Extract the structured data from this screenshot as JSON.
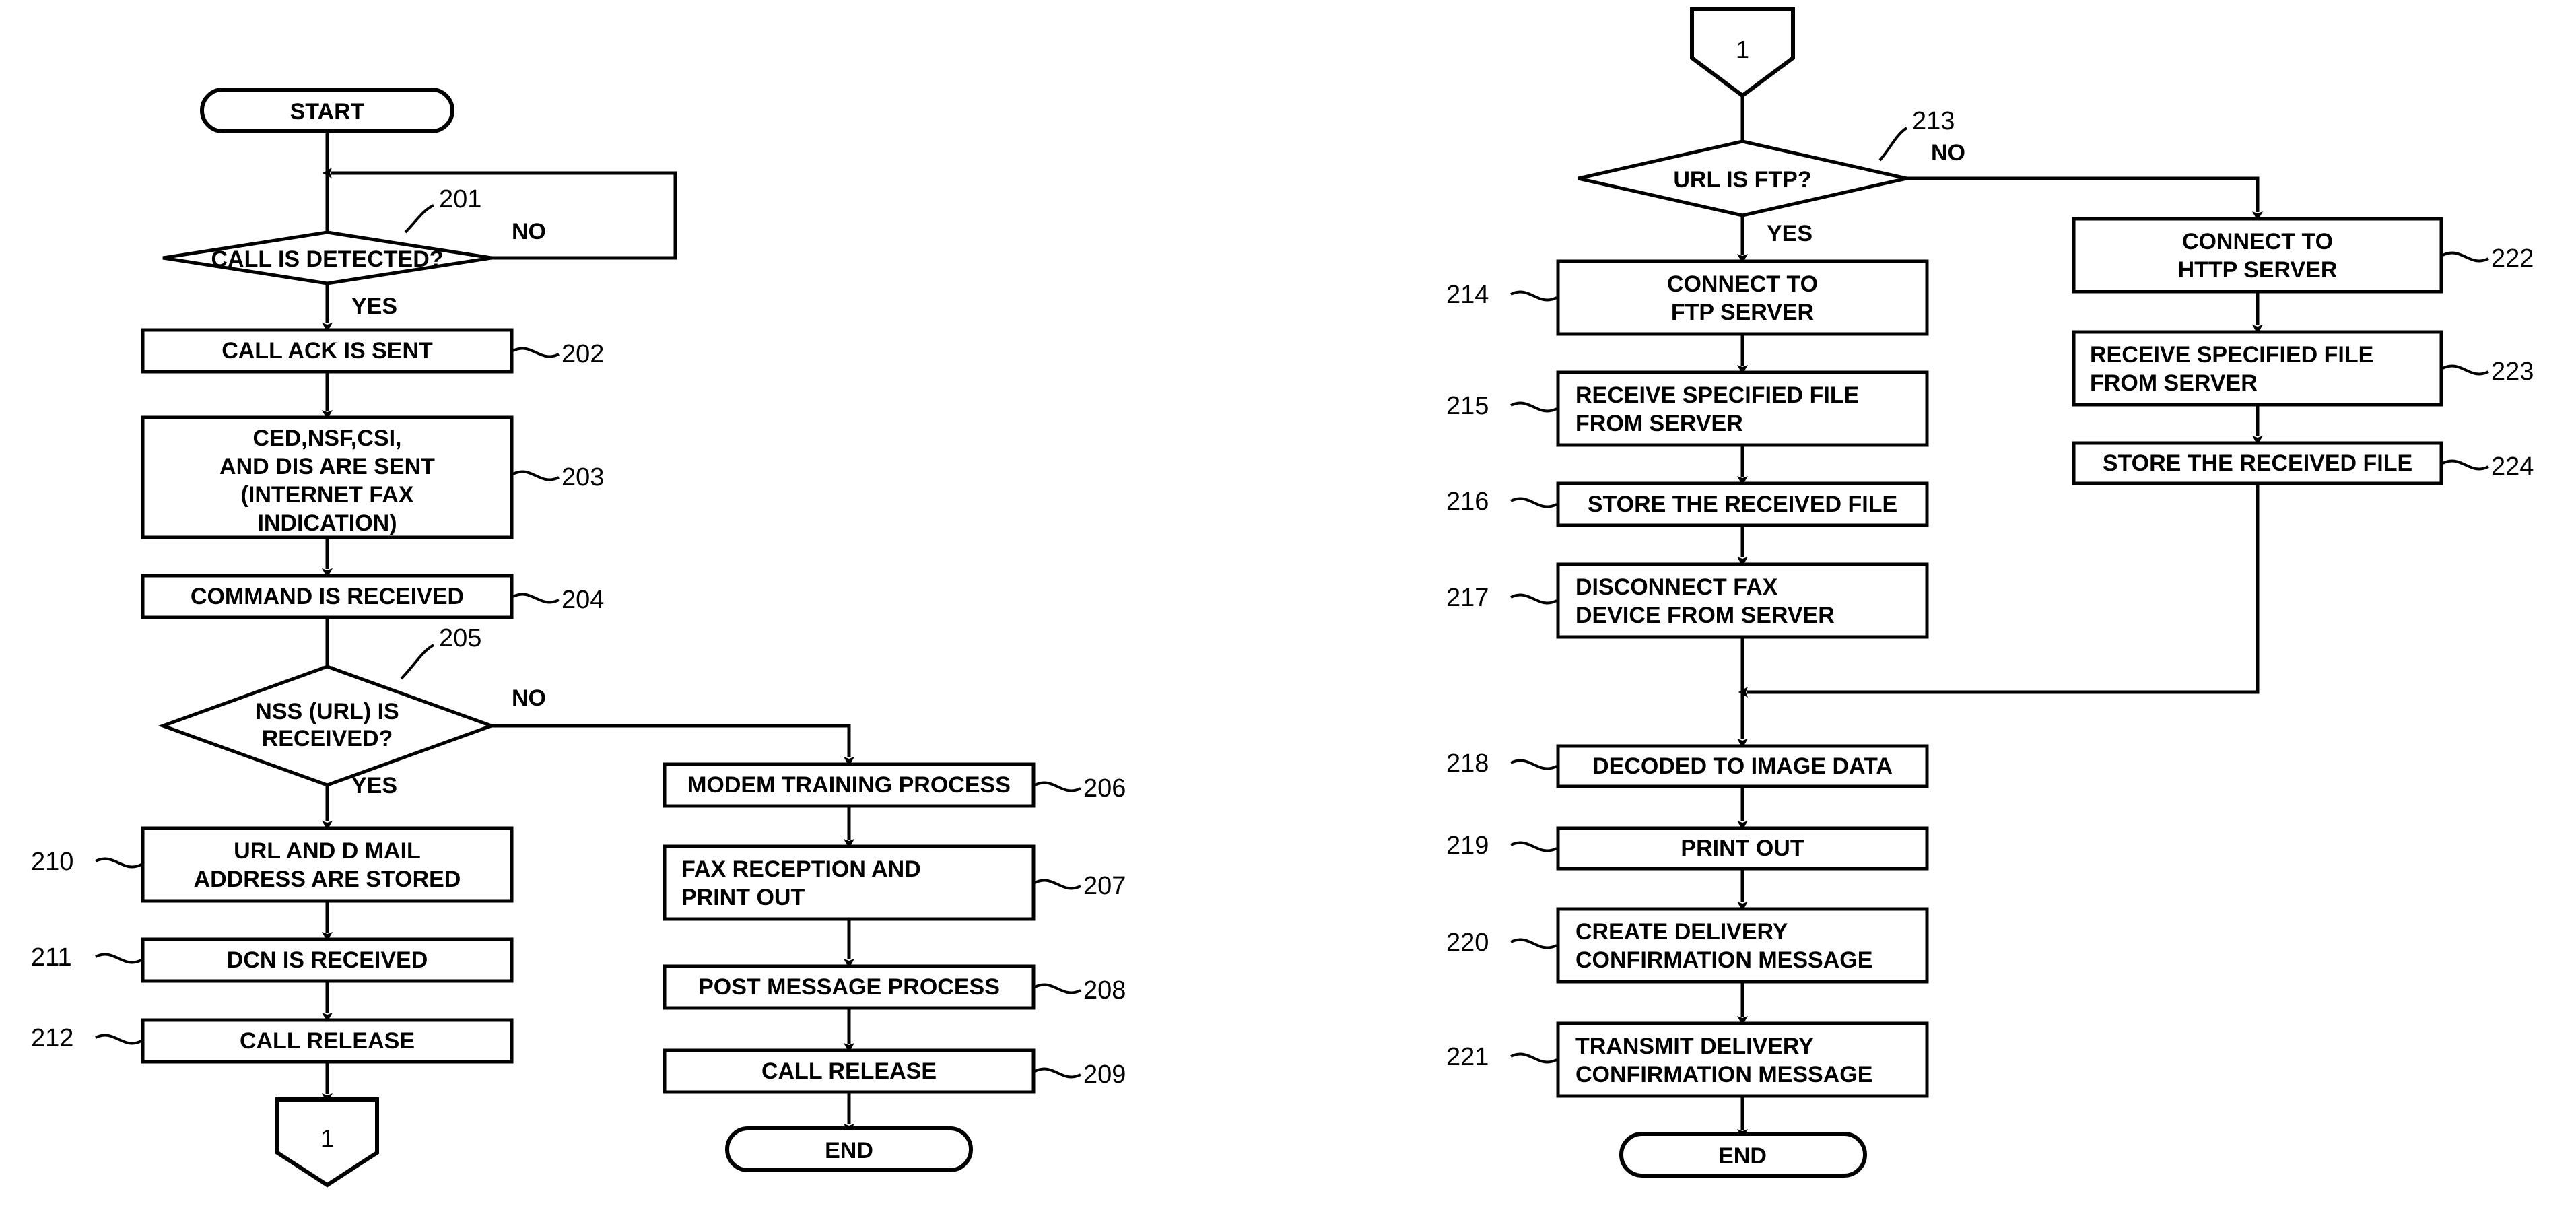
{
  "figure": {
    "kind": "patent-flowchart",
    "background_color": "#ffffff",
    "line_color": "#000000"
  },
  "left_flow": {
    "terminal_start": "START",
    "decision_201": {
      "ref": "201",
      "text": "CALL IS DETECTED?",
      "yes": "YES",
      "no": "NO"
    },
    "box_202": {
      "ref": "202",
      "text": "CALL ACK IS SENT"
    },
    "box_203": {
      "ref": "203",
      "line1": "CED,NSF,CSI,",
      "line2": "AND DIS ARE SENT",
      "line3": "(INTERNET FAX",
      "line4": "INDICATION)"
    },
    "box_204": {
      "ref": "204",
      "text": "COMMAND IS RECEIVED"
    },
    "decision_205": {
      "ref": "205",
      "line1": "NSS (URL) IS",
      "line2": "RECEIVED?",
      "yes": "YES",
      "no": "NO"
    },
    "box_210": {
      "ref": "210",
      "line1": "URL AND D MAIL",
      "line2": "ADDRESS ARE STORED"
    },
    "box_211": {
      "ref": "211",
      "text": "DCN IS RECEIVED"
    },
    "box_212": {
      "ref": "212",
      "text": "CALL RELEASE"
    },
    "connector_out": "1"
  },
  "middle_flow": {
    "box_206": {
      "ref": "206",
      "text": "MODEM TRAINING PROCESS"
    },
    "box_207": {
      "ref": "207",
      "line1": "FAX RECEPTION AND",
      "line2": "PRINT OUT"
    },
    "box_208": {
      "ref": "208",
      "text": "POST MESSAGE PROCESS"
    },
    "box_209": {
      "ref": "209",
      "text": "CALL RELEASE"
    },
    "terminal_end": "END"
  },
  "right_flow": {
    "connector_in": "1",
    "decision_213": {
      "ref": "213",
      "text": "URL IS FTP?",
      "yes": "YES",
      "no": "NO"
    },
    "box_214": {
      "ref": "214",
      "line1": "CONNECT TO",
      "line2": "FTP SERVER"
    },
    "box_215": {
      "ref": "215",
      "line1": "RECEIVE SPECIFIED FILE",
      "line2": "FROM SERVER"
    },
    "box_216": {
      "ref": "216",
      "text": "STORE THE RECEIVED FILE"
    },
    "box_217": {
      "ref": "217",
      "line1": "DISCONNECT FAX",
      "line2": "DEVICE FROM SERVER"
    },
    "box_218": {
      "ref": "218",
      "text": "DECODED TO IMAGE DATA"
    },
    "box_219": {
      "ref": "219",
      "text": "PRINT OUT"
    },
    "box_220": {
      "ref": "220",
      "line1": "CREATE DELIVERY",
      "line2": "CONFIRMATION MESSAGE"
    },
    "box_221": {
      "ref": "221",
      "line1": "TRANSMIT DELIVERY",
      "line2": "CONFIRMATION MESSAGE"
    },
    "terminal_end": "END"
  },
  "http_branch": {
    "box_222": {
      "ref": "222",
      "line1": "CONNECT TO",
      "line2": "HTTP SERVER"
    },
    "box_223": {
      "ref": "223",
      "line1": "RECEIVE SPECIFIED FILE",
      "line2": "FROM SERVER"
    },
    "box_224": {
      "ref": "224",
      "text": "STORE THE RECEIVED FILE"
    }
  }
}
